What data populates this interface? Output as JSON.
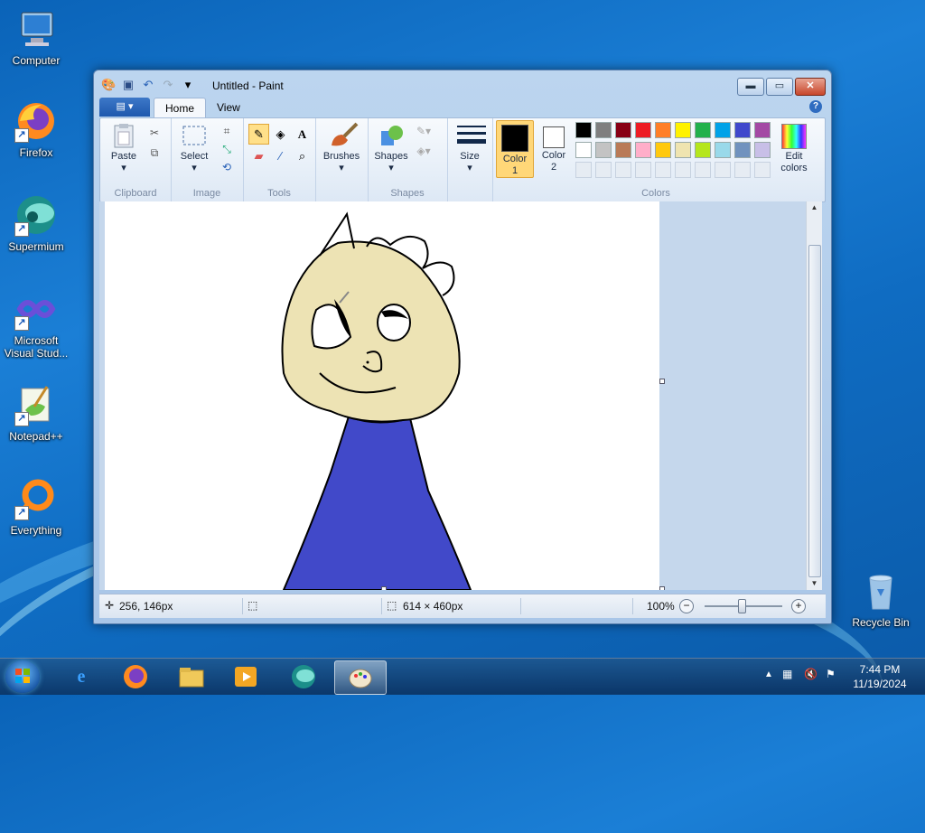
{
  "desktop": {
    "icons": [
      {
        "label": "Computer"
      },
      {
        "label": "Firefox"
      },
      {
        "label": "Supermium"
      },
      {
        "label": "Microsoft Visual Stud..."
      },
      {
        "label": "Notepad++"
      },
      {
        "label": "Everything"
      },
      {
        "label": "Recycle Bin"
      }
    ]
  },
  "window": {
    "title": "Untitled - Paint",
    "controls": {
      "minimize": "▬",
      "maximize": "▭",
      "close": "✕"
    }
  },
  "ribbon": {
    "file_tab": "▤ ▾",
    "tabs": [
      "Home",
      "View"
    ],
    "help": "?",
    "groups": {
      "clipboard": {
        "label": "Clipboard",
        "paste": "Paste"
      },
      "image": {
        "label": "Image",
        "select": "Select"
      },
      "tools": {
        "label": "Tools"
      },
      "brushes": {
        "label": "Brushes"
      },
      "shapes": {
        "label": "Shapes",
        "shapes_btn": "Shapes"
      },
      "size": {
        "label": "Size"
      },
      "colors": {
        "label": "Colors",
        "color1": "Color 1",
        "color1_a": "Color",
        "color1_b": "1",
        "color2_a": "Color",
        "color2_b": "2",
        "edit_a": "Edit",
        "edit_b": "colors",
        "color1_value": "#000000",
        "color2_value": "#ffffff",
        "palette_row1": [
          "#000000",
          "#7f7f7f",
          "#880015",
          "#ed1c24",
          "#ff7f27",
          "#fff200",
          "#22b14c",
          "#00a2e8",
          "#3f48cc",
          "#a349a4"
        ],
        "palette_row2": [
          "#ffffff",
          "#c3c3c3",
          "#b97a57",
          "#ffaec9",
          "#ffc90e",
          "#efe4b0",
          "#b5e61d",
          "#99d9ea",
          "#7092be",
          "#c8bfe7"
        ]
      }
    }
  },
  "drawing": {
    "face_color": "#ede3b4",
    "body_color": "#4149c9"
  },
  "status": {
    "cursor_pos": "256, 146px",
    "canvas_size": "614 × 460px",
    "zoom": "100%"
  },
  "taskbar": {
    "time": "7:44 PM",
    "date": "11/19/2024"
  }
}
